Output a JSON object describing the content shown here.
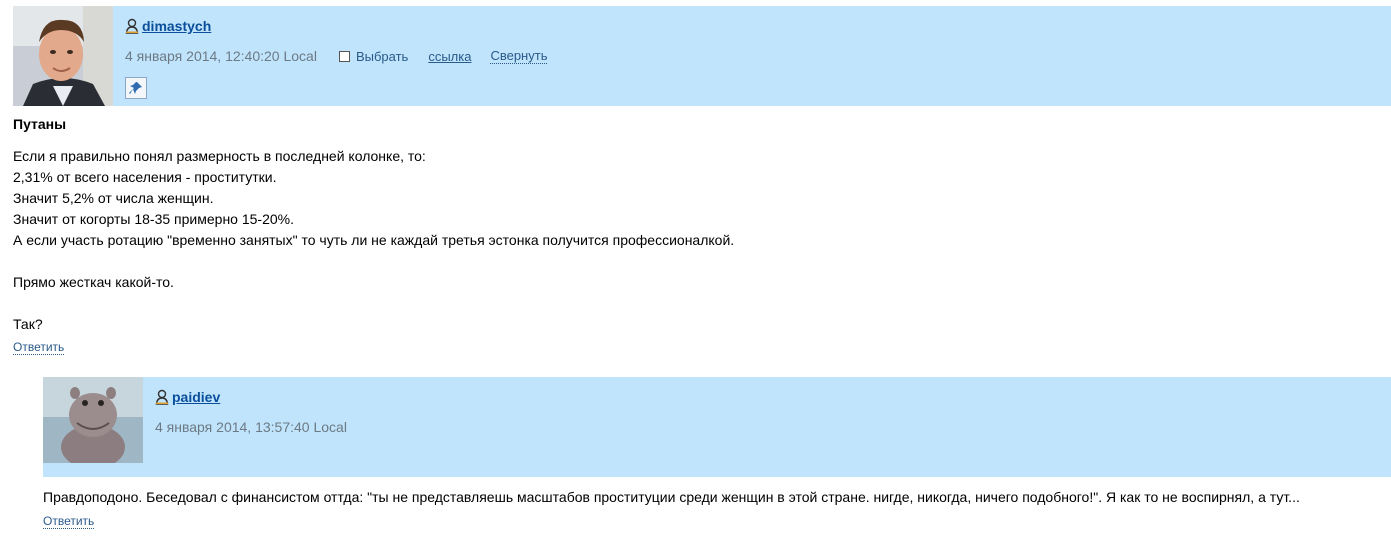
{
  "comments": [
    {
      "username": "dimastych",
      "date": "4 января 2014, 12:40:20 Local",
      "select_label": "Выбрать",
      "link_label": "ссылка",
      "collapse_label": "Свернуть",
      "title": "Путаны",
      "lines": [
        "Если я правильно понял размерность в последней колонке, то:",
        "2,31% от всего населения - проститутки.",
        "Значит 5,2% от числа женщин.",
        "Значит от когорты 18-35 примерно 15-20%.",
        "А если участь ротацию \"временно занятых\" то чуть ли не каждай третья эстонка получится профессионалкой.",
        "",
        "Прямо жесткач какой-то.",
        "",
        "Так?"
      ],
      "reply_label": "Ответить"
    },
    {
      "username": "paidiev",
      "date": "4 января 2014, 13:57:40 Local",
      "text": "Правдоподоно. Беседовал с финансистом оттда: \"ты не представляешь масштабов проституции среди женщин в этой стране. нигде, никогда, ничего подобного!\". Я как то не воспирнял, а тут...",
      "reply_label": "Ответить"
    }
  ],
  "icons": {
    "user": "user-icon",
    "pin": "pin-icon"
  },
  "colors": {
    "header_bg": "#bfe4fb",
    "link": "#2a5a8a",
    "username": "#0b4f9c",
    "date": "#6d7a85"
  }
}
